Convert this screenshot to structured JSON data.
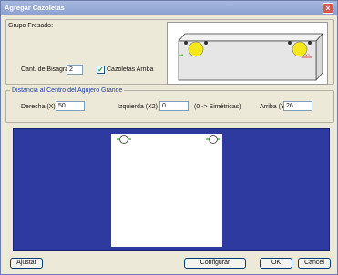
{
  "window": {
    "title": "Agregar Cazoletas"
  },
  "group": {
    "label": "Grupo Fresado:"
  },
  "fields": {
    "cant_bisagras": {
      "label": "Cant. de Bisagras:",
      "value": "2"
    },
    "cazoletas_arriba": {
      "label": "Cazoletas Arriba",
      "checked": true
    }
  },
  "distance": {
    "label": "Distancia al Centro del Agujero Grande",
    "derecha": {
      "label": "Derecha (X) =",
      "value": "50"
    },
    "izquierda": {
      "label": "Izquierda (X2) =",
      "value": "0",
      "hint": "(0 -> Simétricas)"
    },
    "arriba": {
      "label": "Arriba (Y) =",
      "value": "26"
    }
  },
  "preview": {
    "marker_label": "X2"
  },
  "buttons": {
    "ajustar": "Ajustar",
    "configurar": "Configurar",
    "ok": "OK",
    "cancel": "Cancel"
  },
  "colors": {
    "canvas_bg": "#2f3aa0",
    "hole_fill": "#f4e81a",
    "accent_green": "#22aa22"
  }
}
